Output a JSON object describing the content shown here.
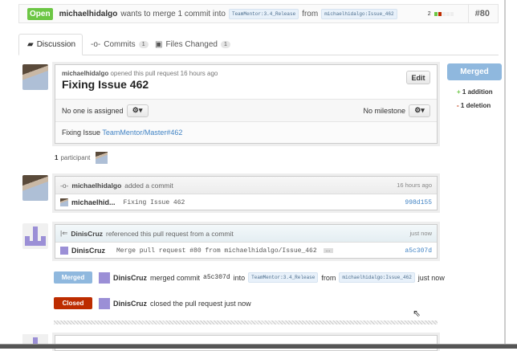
{
  "header": {
    "status": "Open",
    "author": "michaelhidalgo",
    "action": "wants to merge 1 commit into",
    "base": "TeamMentor:3.4_Release",
    "from": "from",
    "head": "michaelhidalgo:Issue_462",
    "diff_count": "2",
    "number": "#80"
  },
  "tabs": [
    {
      "label": "Discussion",
      "icon": "discussion-icon"
    },
    {
      "label": "Commits",
      "count": "1",
      "icon": "commit-icon"
    },
    {
      "label": "Files Changed",
      "count": "1",
      "icon": "file-diff-icon"
    }
  ],
  "pr": {
    "author": "michaelhidalgo",
    "opened": "opened this pull request 16 hours ago",
    "title": "Fixing Issue 462",
    "edit": "Edit",
    "assignee": "No one is assigned",
    "milestone": "No milestone",
    "body_text": "Fixing Issue ",
    "body_link": "TeamMentor/Master#462"
  },
  "sidebar": {
    "state": "Merged",
    "additions": "1 addition",
    "deletions": "1 deletion"
  },
  "participants": {
    "count": "1",
    "label": "participant"
  },
  "commit_event": {
    "author": "michaelhidalgo",
    "action": "added a commit",
    "time": "16 hours ago",
    "commit_author": "michaelhid...",
    "message": "Fixing Issue 462",
    "sha": "998d155"
  },
  "ref_event": {
    "author": "DinisCruz",
    "action": "referenced this pull request from a commit",
    "time": "just now",
    "commit_author": "DinisCruz",
    "message": "Merge pull request #80 from michaelhidalgo/Issue_462",
    "ellipsis": "…",
    "sha": "a5c307d"
  },
  "merged_event": {
    "badge": "Merged",
    "author": "DinisCruz",
    "action": "merged commit",
    "sha": "a5c307d",
    "into": "into",
    "base": "TeamMentor:3.4_Release",
    "from": "from",
    "head": "michaelhidalgo:Issue_462",
    "time": "just now"
  },
  "closed_event": {
    "badge": "Closed",
    "author": "DinisCruz",
    "action": "closed the pull request just now"
  },
  "colors": {
    "open": "#6cc644",
    "merged": "#8fb8de",
    "closed": "#bd2c00",
    "link": "#4183c4"
  }
}
